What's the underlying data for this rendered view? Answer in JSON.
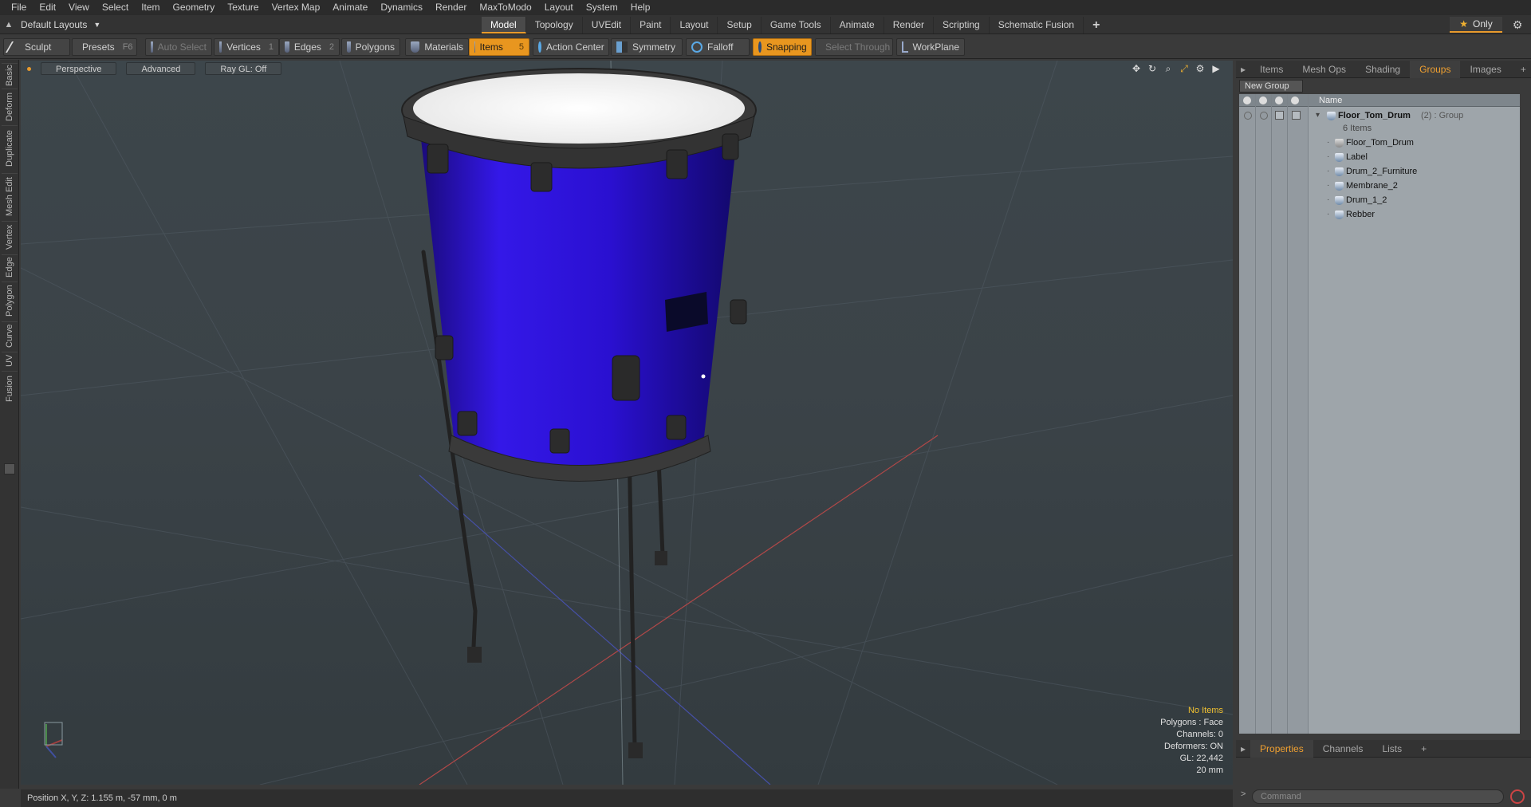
{
  "menu": [
    "File",
    "Edit",
    "View",
    "Select",
    "Item",
    "Geometry",
    "Texture",
    "Vertex Map",
    "Animate",
    "Dynamics",
    "Render",
    "MaxToModo",
    "Layout",
    "System",
    "Help"
  ],
  "layout_selector": "Default Layouts",
  "tabs": [
    "Model",
    "Topology",
    "UVEdit",
    "Paint",
    "Layout",
    "Setup",
    "Game Tools",
    "Animate",
    "Render",
    "Scripting",
    "Schematic Fusion"
  ],
  "active_tab": "Model",
  "only_label": "Only",
  "toolbar": {
    "sculpt": "Sculpt",
    "presets": "Presets",
    "presets_key": "F6",
    "auto_select": "Auto Select",
    "vertices": "Vertices",
    "vertices_key": "1",
    "edges": "Edges",
    "edges_key": "2",
    "polygons": "Polygons",
    "materials": "Materials",
    "items": "Items",
    "items_key": "5",
    "action_center": "Action Center",
    "symmetry": "Symmetry",
    "falloff": "Falloff",
    "snapping": "Snapping",
    "select_through": "Select Through",
    "workplane": "WorkPlane"
  },
  "left_tabs": [
    "Basic",
    "Deform",
    "Duplicate",
    "Mesh Edit",
    "Vertex",
    "Edge",
    "Polygon",
    "Curve",
    "UV",
    "Fusion"
  ],
  "viewport": {
    "view": "Perspective",
    "shading": "Advanced",
    "raygl": "Ray GL: Off",
    "info": {
      "selection": "No Items",
      "polygons": "Polygons : Face",
      "channels": "Channels: 0",
      "deformers": "Deformers: ON",
      "gl": "GL: 22,442",
      "unit": "20 mm"
    }
  },
  "status": "Position X, Y, Z:   1.155 m, -57 mm, 0 m",
  "right_panel": {
    "tabs": [
      "Items",
      "Mesh Ops",
      "Shading",
      "Groups",
      "Images"
    ],
    "active_tab": "Groups",
    "new_group": "New Group",
    "col_name": "Name",
    "group": {
      "name": "Floor_Tom_Drum",
      "suffix": "(2) : Group",
      "count": "6 Items"
    },
    "items": [
      "Floor_Tom_Drum",
      "Label",
      "Drum_2_Furniture",
      "Membrane_2",
      "Drum_1_2",
      "Rebber"
    ],
    "bottom_tabs": [
      "Properties",
      "Channels",
      "Lists"
    ],
    "bottom_active": "Properties",
    "command_placeholder": "Command"
  },
  "colors": {
    "accent": "#e89a2c",
    "drum_shell": "#2a10d8",
    "drum_head": "#f2f2f2"
  }
}
